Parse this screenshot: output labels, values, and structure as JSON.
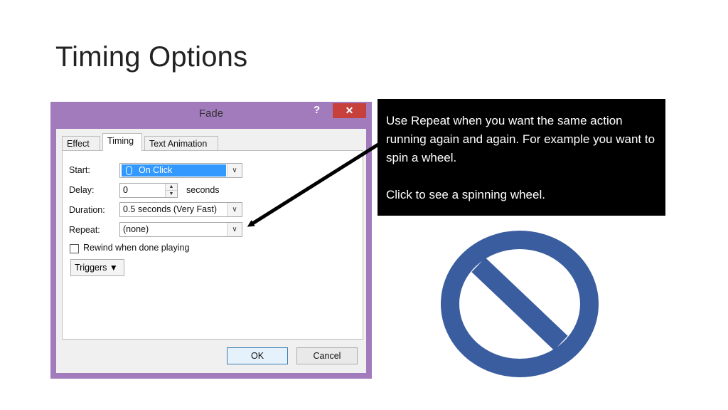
{
  "slide": {
    "title": "Timing Options"
  },
  "dialog": {
    "title": "Fade",
    "help": "?",
    "close": "✕",
    "tabs": [
      "Effect",
      "Timing",
      "Text Animation"
    ],
    "fields": {
      "start_label": "Start:",
      "start_value": "On Click",
      "delay_label": "Delay:",
      "delay_value": "0",
      "delay_unit": "seconds",
      "duration_label": "Duration:",
      "duration_value": "0.5 seconds (Very Fast)",
      "repeat_label": "Repeat:",
      "repeat_value": "(none)",
      "rewind_label": "Rewind when done playing",
      "triggers_label": "Triggers"
    },
    "ok_label": "OK",
    "cancel_label": "Cancel"
  },
  "callout": {
    "line1": "Use Repeat when you want the same action running again and again. For example you want to spin a wheel.",
    "line2": "Click to see a spinning wheel."
  },
  "colors": {
    "dialog_frame": "#a27bbd",
    "close_button": "#c7413c",
    "selection": "#3399ff",
    "wheel": "#3a5d9f"
  }
}
